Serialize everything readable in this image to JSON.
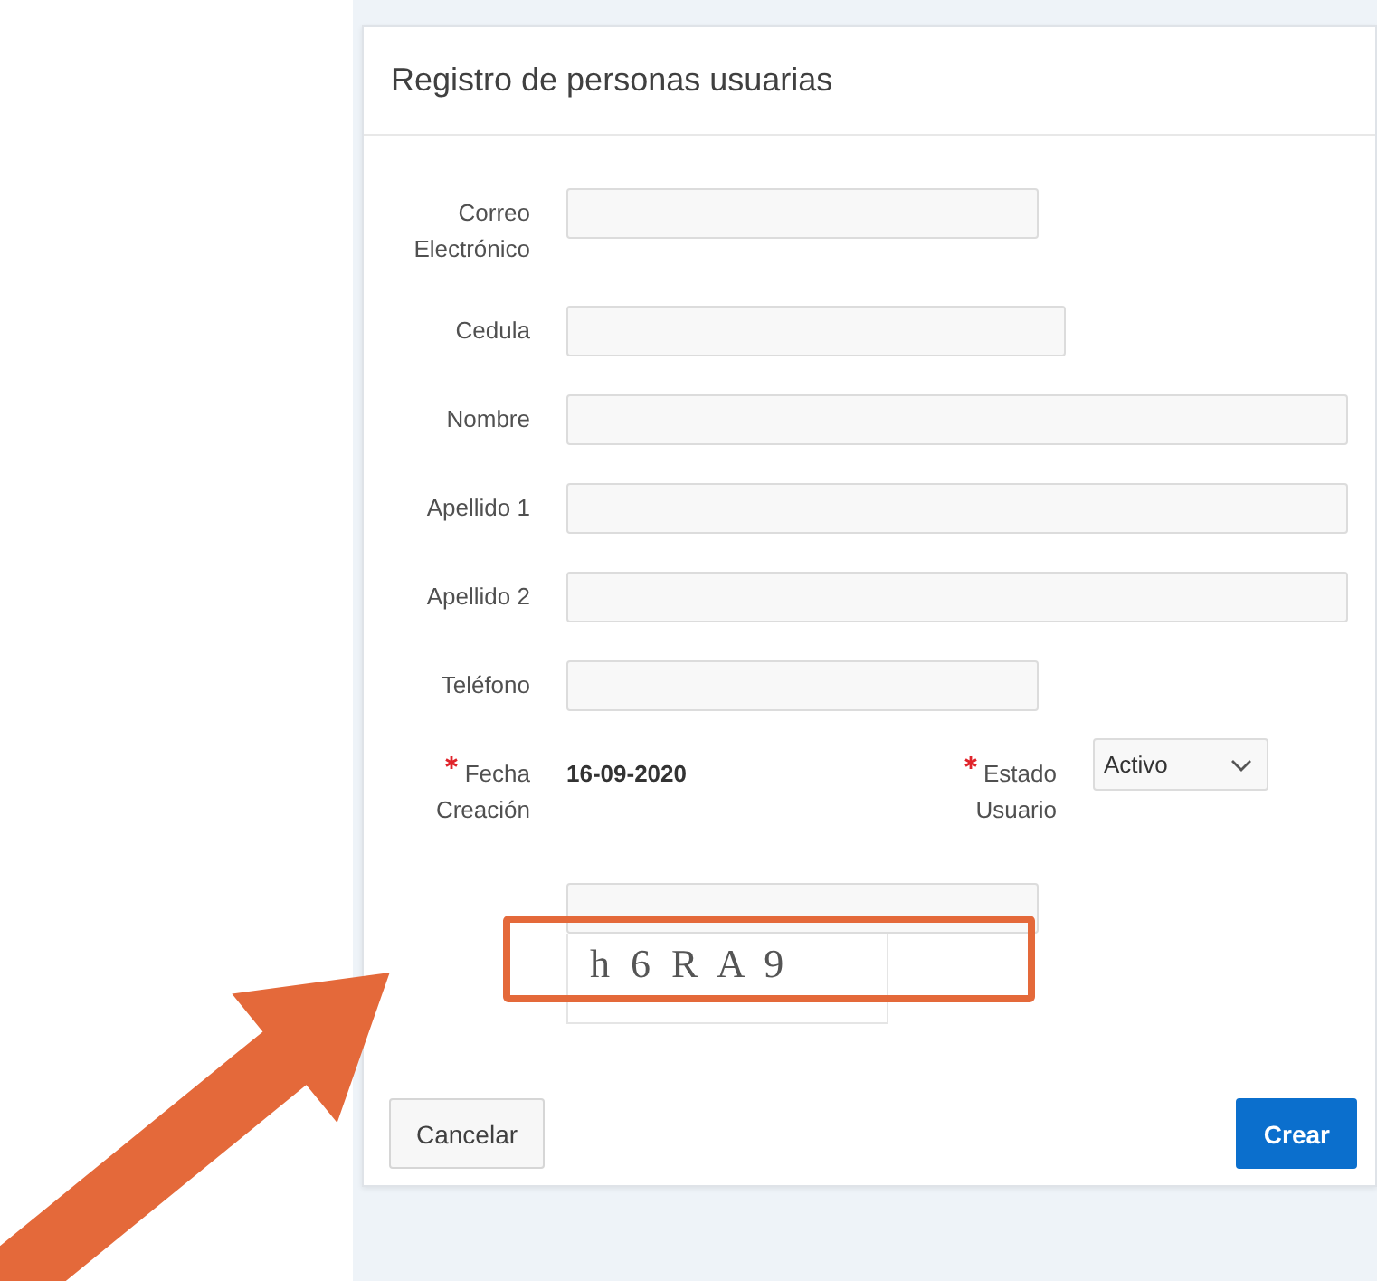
{
  "dialog": {
    "title": "Registro de personas usuarias"
  },
  "fields": [
    {
      "label": "Correo Electrónico",
      "kind": "short"
    },
    {
      "label": "Cedula",
      "kind": "medium"
    },
    {
      "label": "Nombre",
      "kind": "long"
    },
    {
      "label": "Apellido 1",
      "kind": "long"
    },
    {
      "label": "Apellido 2",
      "kind": "long"
    },
    {
      "label": "Teléfono",
      "kind": "short"
    }
  ],
  "date_field": {
    "label": "Fecha Creación",
    "required": true,
    "value": "16-09-2020"
  },
  "status_field": {
    "label": "Estado Usuario",
    "required": true,
    "value": "Activo"
  },
  "captcha": {
    "text": "h 6 R A 9",
    "highlighted": true
  },
  "buttons": [
    {
      "label": "Cancelar",
      "kind": "secondary"
    },
    {
      "label": "Crear",
      "kind": "primary"
    }
  ]
}
